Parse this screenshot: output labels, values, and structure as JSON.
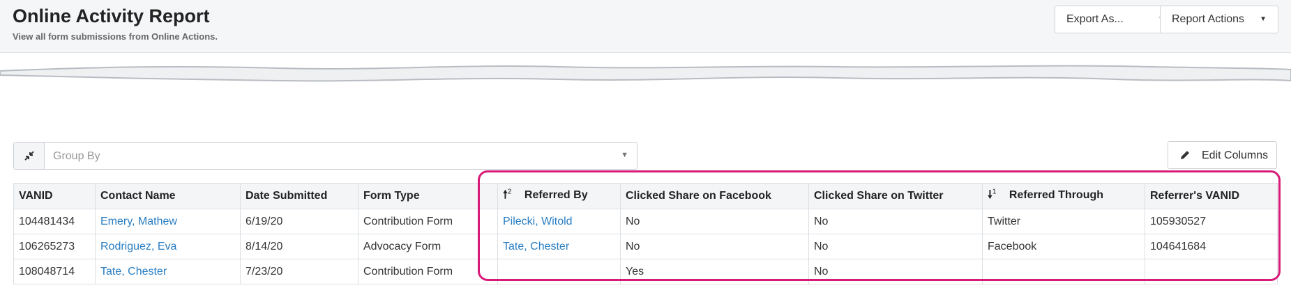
{
  "header": {
    "title": "Online Activity Report",
    "subtitle": "View all form submissions from Online Actions.",
    "export_label": "Export As...",
    "report_actions_label": "Report Actions"
  },
  "toolbar": {
    "group_by_placeholder": "Group By",
    "edit_columns_label": "Edit Columns"
  },
  "table": {
    "columns": [
      {
        "label": "VANID"
      },
      {
        "label": "Contact Name"
      },
      {
        "label": "Date Submitted"
      },
      {
        "label": "Form Type"
      },
      {
        "label": "Referred By",
        "sort": "asc",
        "sort_order": "2"
      },
      {
        "label": "Clicked Share on Facebook"
      },
      {
        "label": "Clicked Share on Twitter"
      },
      {
        "label": "Referred Through",
        "sort": "desc",
        "sort_order": "1"
      },
      {
        "label": "Referrer's VANID"
      }
    ],
    "rows": [
      [
        "104481434",
        "Emery, Mathew",
        "6/19/20",
        "Contribution Form",
        "Pilecki, Witold",
        "No",
        "No",
        "Twitter",
        "105930527"
      ],
      [
        "106265273",
        "Rodriguez, Eva",
        "8/14/20",
        "Advocacy Form",
        "Tate, Chester",
        "No",
        "No",
        "Facebook",
        "104641684"
      ],
      [
        "108048714",
        "Tate, Chester",
        "7/23/20",
        "Contribution Form",
        "",
        "Yes",
        "No",
        "",
        ""
      ]
    ]
  },
  "colors": {
    "link": "#2a7ec2",
    "highlight": "#d81b78",
    "header_bg": "#f5f6f8"
  }
}
